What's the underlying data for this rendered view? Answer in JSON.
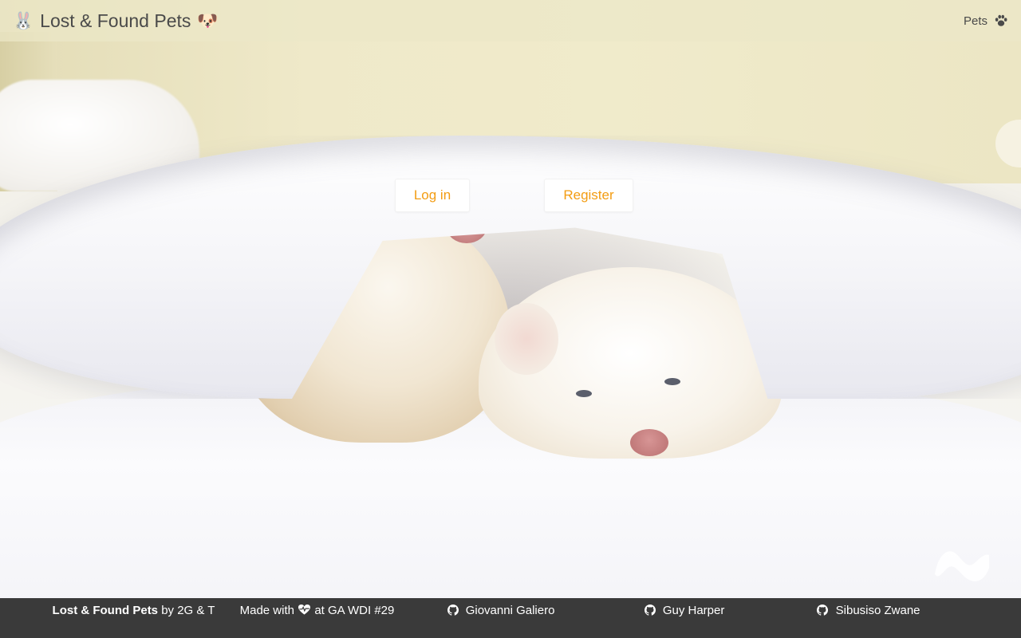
{
  "navbar": {
    "brand_prefix_emoji": "🐰",
    "brand_title": "Lost & Found Pets",
    "brand_suffix_emoji": "🐶",
    "pets_label": "Pets",
    "pets_icon": "paw-icon"
  },
  "hero": {
    "login_label": "Log in",
    "register_label": "Register",
    "watermark_icon": "wave-logo-icon"
  },
  "footer": {
    "app_name": "Lost & Found Pets",
    "by_text": "by 2G & T",
    "made_prefix": "Made with",
    "made_icon": "heart-pulse-icon",
    "made_suffix": "at GA WDI #29",
    "developers": [
      {
        "name": "Giovanni Galiero",
        "icon": "github-icon"
      },
      {
        "name": "Guy Harper",
        "icon": "github-icon"
      },
      {
        "name": "Sibusiso Zwane",
        "icon": "github-icon"
      }
    ]
  },
  "colors": {
    "accent": "#f39c12",
    "footer_bg": "#3a3a3a",
    "navbar_bg": "#ece8c8"
  }
}
